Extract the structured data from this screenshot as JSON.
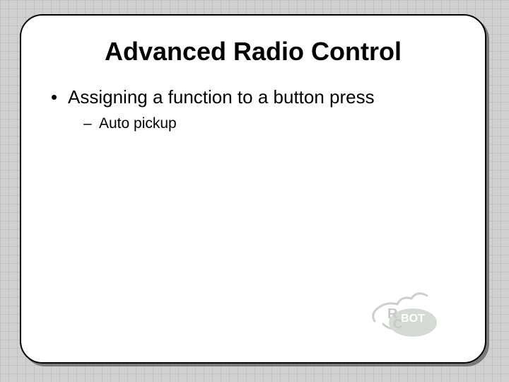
{
  "slide": {
    "title": "Advanced Radio Control",
    "bullets": [
      {
        "text": "Assigning a function to a button press",
        "sub": [
          {
            "text": "Auto pickup"
          }
        ]
      }
    ]
  },
  "logo": {
    "name": "RC BOT"
  }
}
